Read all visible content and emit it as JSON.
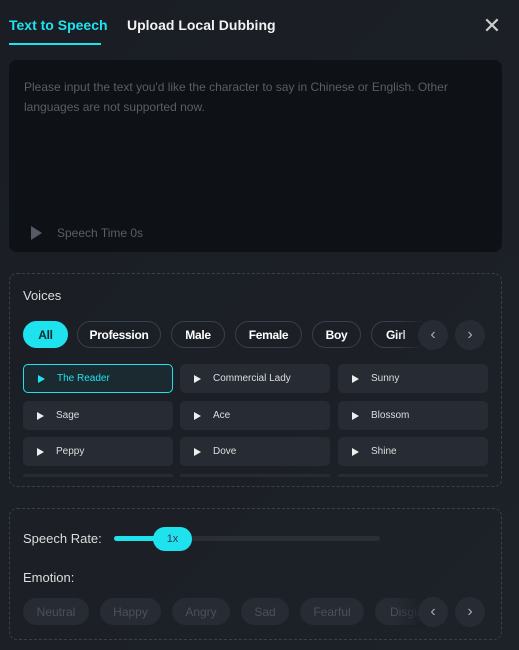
{
  "tabs": [
    {
      "label": "Text to Speech",
      "active": true
    },
    {
      "label": "Upload Local Dubbing",
      "active": false
    }
  ],
  "close_icon": "close-icon",
  "text_input": {
    "value": "",
    "placeholder": "Please input the text you'd like the character to say in Chinese or English. Other languages are not supported now.",
    "speech_time": "Speech Time 0s"
  },
  "voices": {
    "title": "Voices",
    "filters": [
      "All",
      "Profession",
      "Male",
      "Female",
      "Boy",
      "Girl"
    ],
    "active_filter": "All",
    "items": [
      "The Reader",
      "Commercial Lady",
      "Sunny",
      "Sage",
      "Ace",
      "Blossom",
      "Peppy",
      "Dove",
      "Shine"
    ],
    "selected": "The Reader"
  },
  "speech_rate": {
    "label": "Speech Rate:",
    "value": "1x"
  },
  "emotion": {
    "label": "Emotion:",
    "options": [
      "Neutral",
      "Happy",
      "Angry",
      "Sad",
      "Fearful",
      "Disgust"
    ]
  },
  "colors": {
    "accent": "#1ee3ef",
    "background": "#1b1f26",
    "panel": "#0e1116"
  }
}
